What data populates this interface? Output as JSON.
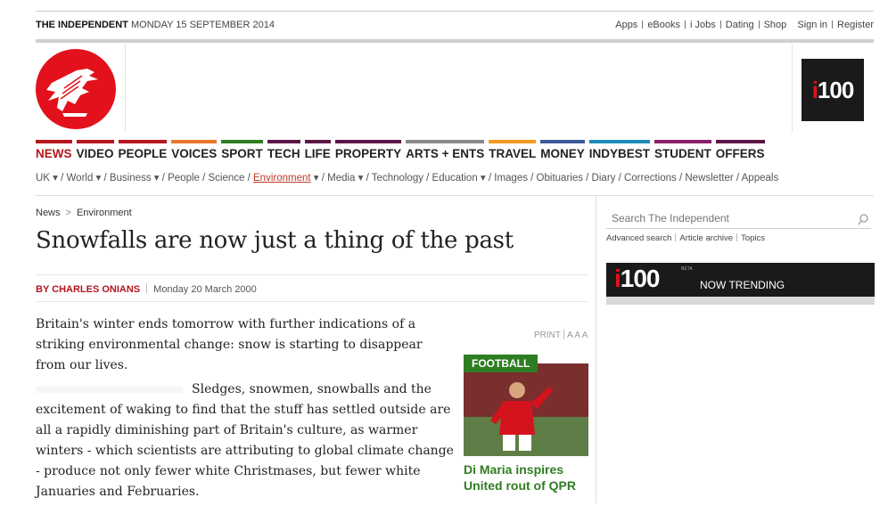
{
  "masthead": {
    "brand": "THE INDEPENDENT",
    "date": "MONDAY 15 SEPTEMBER 2014"
  },
  "toplinks": [
    "Apps",
    "eBooks",
    "i Jobs",
    "Dating",
    "Shop",
    "Sign in",
    "Register"
  ],
  "i100": {
    "i": "i",
    "num": "100"
  },
  "nav": [
    {
      "label": "NEWS",
      "color": "#b4151e",
      "active": true
    },
    {
      "label": "VIDEO",
      "color": "#b4151e"
    },
    {
      "label": "PEOPLE",
      "color": "#b4151e"
    },
    {
      "label": "VOICES",
      "color": "#e8752b"
    },
    {
      "label": "SPORT",
      "color": "#2f7d22"
    },
    {
      "label": "TECH",
      "color": "#5c1547"
    },
    {
      "label": "LIFE",
      "color": "#5c1547"
    },
    {
      "label": "PROPERTY",
      "color": "#5c1547"
    },
    {
      "label": "ARTS + ENTS",
      "color": "#888888"
    },
    {
      "label": "TRAVEL",
      "color": "#f39a1e"
    },
    {
      "label": "MONEY",
      "color": "#3c5a9a"
    },
    {
      "label": "INDYBEST",
      "color": "#1b8bb8"
    },
    {
      "label": "STUDENT",
      "color": "#8b1e6b"
    },
    {
      "label": "OFFERS",
      "color": "#5c1547"
    }
  ],
  "subnav": "UK ▾ / World ▾ / Business ▾ / People / Science / ",
  "subnav_active": "Environment",
  "subnav_rest": " ▾ / Media ▾ / Technology / Education ▾ / Images / Obituaries / Diary / Corrections / Newsletter / Appeals",
  "breadcrumb": {
    "first": "News",
    "sep": ">",
    "second": "Environment"
  },
  "headline": "Snowfalls are now just a thing of the past",
  "byline": {
    "author": "BY CHARLES ONIANS",
    "date": "Monday 20 March 2000"
  },
  "body": {
    "p1": "Britain's winter ends tomorrow with further indications of a striking environmental change: snow is starting to disappear from our lives.",
    "p2": "Sledges, snowmen, snowballs and the excitement of waking to find that the stuff has settled outside are all a rapidly diminishing part of Britain's culture, as warmer winters - which scientists are attributing to global climate change - produce not only fewer white Christmases, but fewer white Januaries and Februaries."
  },
  "print": {
    "label": "PRINT",
    "sizes": "A A A"
  },
  "football": {
    "tag": "FOOTBALL",
    "caption": "Di Maria inspires United rout of QPR"
  },
  "search": {
    "placeholder": "Search The Independent",
    "links": [
      "Advanced search",
      "Article archive",
      "Topics"
    ]
  },
  "trending": {
    "logo_i": "i",
    "logo_num": "100",
    "beta": "BETA",
    "label": "NOW TRENDING"
  }
}
